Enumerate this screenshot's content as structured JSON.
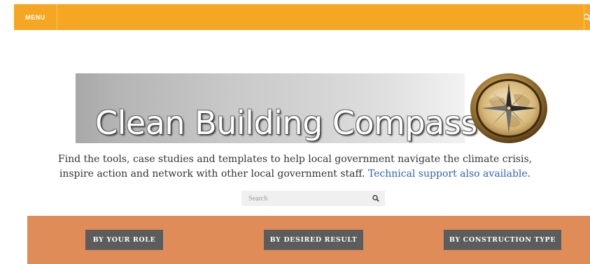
{
  "header": {
    "menu_label": "MENU",
    "accent_color": "#f5a623",
    "search_icon": "search-icon"
  },
  "banner": {
    "title": "Clean Building Compass",
    "logo_icon": "compass-icon"
  },
  "intro": {
    "text": "Find the tools, case studies and templates to help local government navigate the climate crisis, inspire action and network with other local government staff. ",
    "link_text": "Technical support also available",
    "suffix": "."
  },
  "search": {
    "placeholder": "Search",
    "icon": "search-icon"
  },
  "filters": {
    "panel_color": "#df8c58",
    "by_role": "BY YOUR ROLE",
    "by_result": "BY DESIRED RESULT",
    "by_construction": "BY CONSTRUCTION TYPE"
  }
}
